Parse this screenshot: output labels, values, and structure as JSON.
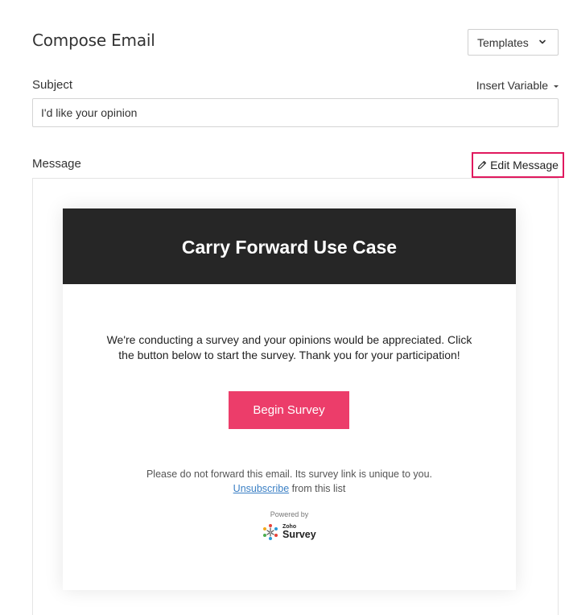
{
  "header": {
    "title": "Compose Email",
    "templates_label": "Templates"
  },
  "subject": {
    "label": "Subject",
    "insert_variable_label": "Insert Variable",
    "value": "I'd like your opinion"
  },
  "message": {
    "label": "Message",
    "edit_label": "Edit Message"
  },
  "email_preview": {
    "header_title": "Carry Forward Use Case",
    "header_bg_color": "#262626",
    "body_text": "We're conducting a survey and your opinions would be appreciated. Click the button below to start the survey. Thank you for your participation!",
    "button_label": "Begin Survey",
    "button_color": "#ec3d6a",
    "footer_note": "Please do not forward this email. Its survey link is unique to you.",
    "unsubscribe_link": "Unsubscribe",
    "unsubscribe_suffix": " from this list",
    "powered_by": "Powered by",
    "logo_small": "Zoho",
    "logo_main": "Survey"
  },
  "accent_color": "#e0195e"
}
